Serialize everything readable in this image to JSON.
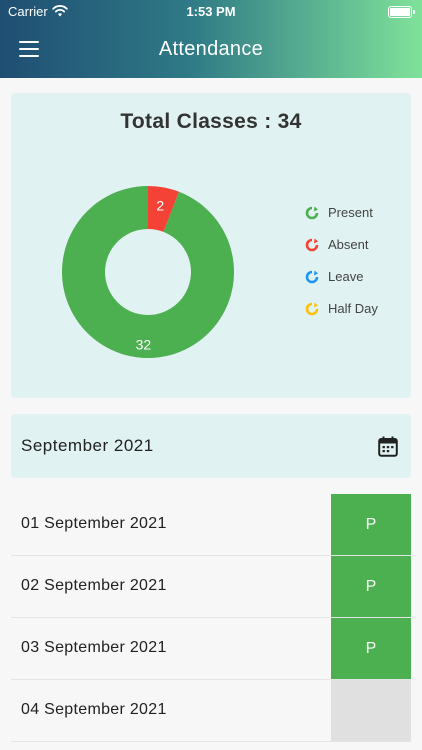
{
  "status_bar": {
    "carrier": "Carrier",
    "time": "1:53 PM"
  },
  "header": {
    "title": "Attendance"
  },
  "summary": {
    "title": "Total Classes : 34",
    "chart_data": {
      "type": "pie",
      "slices": [
        {
          "label": "Present",
          "value": 32,
          "color": "#4caf50"
        },
        {
          "label": "Absent",
          "value": 2,
          "color": "#f44336"
        },
        {
          "label": "Leave",
          "value": 0,
          "color": "#2196f3"
        },
        {
          "label": "Half Day",
          "value": 0,
          "color": "#ffc107"
        }
      ],
      "legend_placement": "right",
      "donut": true
    },
    "legend": [
      {
        "label": "Present",
        "color": "#4caf50"
      },
      {
        "label": "Absent",
        "color": "#f44336"
      },
      {
        "label": "Leave",
        "color": "#2196f3"
      },
      {
        "label": "Half Day",
        "color": "#ffc107"
      }
    ]
  },
  "month": {
    "label": "September 2021"
  },
  "days": [
    {
      "date": "01 September 2021",
      "status": "P",
      "color": "#4caf50"
    },
    {
      "date": "02 September 2021",
      "status": "P",
      "color": "#4caf50"
    },
    {
      "date": "03 September 2021",
      "status": "P",
      "color": "#4caf50"
    },
    {
      "date": "04 September 2021",
      "status": "",
      "color": "#e0e0e0"
    }
  ]
}
